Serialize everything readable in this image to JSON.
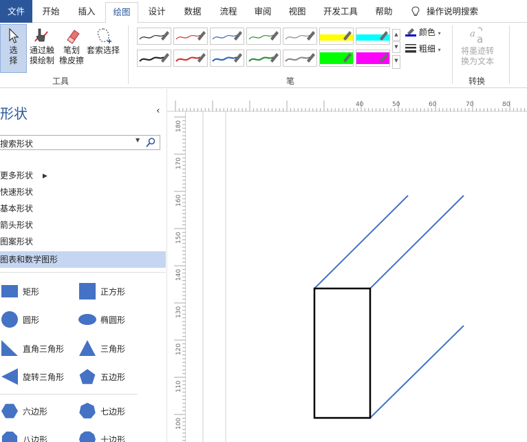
{
  "tabs": [
    {
      "label": "文件"
    },
    {
      "label": "开始"
    },
    {
      "label": "插入"
    },
    {
      "label": "绘图"
    },
    {
      "label": "设计"
    },
    {
      "label": "数据"
    },
    {
      "label": "流程"
    },
    {
      "label": "审阅"
    },
    {
      "label": "视图"
    },
    {
      "label": "开发工具"
    },
    {
      "label": "帮助"
    }
  ],
  "tell_me": "操作说明搜索",
  "ribbon": {
    "tools": {
      "select_line1": "选",
      "select_line2": "择",
      "touch_line1": "通过触",
      "touch_line2": "摸绘制",
      "eraser_line1": "笔划",
      "eraser_line2": "橡皮擦",
      "lasso": "套索选择",
      "group_label": "工具"
    },
    "pens": {
      "group_label": "笔",
      "colors": [
        "#262626",
        "#d13438",
        "#2e6bb8",
        "#2f8f3c",
        "#8a8a8a",
        "#ffff00",
        "#00ffff",
        "#262626",
        "#d13438",
        "#2e6bb8",
        "#2f8f3c",
        "#8a8a8a",
        "#00ff00",
        "#ff00ff"
      ]
    },
    "color_label": "颜色",
    "thickness_label": "粗细",
    "convert": {
      "line1": "将墨迹转",
      "line2": "换为文本",
      "group_label": "转换"
    }
  },
  "shapes_pane": {
    "title": "形状",
    "search_placeholder": "搜索形状",
    "stencils": [
      "更多形状",
      "快速形状",
      "基本形状",
      "箭头形状",
      "图案形状",
      "图表和数学图形"
    ],
    "items": [
      {
        "label": "矩形",
        "icon": "rectangle-icon"
      },
      {
        "label": "正方形",
        "icon": "square-icon"
      },
      {
        "label": "圆形",
        "icon": "circle-icon"
      },
      {
        "label": "椭圆形",
        "icon": "ellipse-icon"
      },
      {
        "label": "直角三角形",
        "icon": "right-triangle-icon"
      },
      {
        "label": "三角形",
        "icon": "triangle-icon"
      },
      {
        "label": "旋转三角形",
        "icon": "rotated-triangle-icon"
      },
      {
        "label": "五边形",
        "icon": "pentagon-icon"
      },
      {
        "label": "六边形",
        "icon": "hexagon-icon"
      },
      {
        "label": "七边形",
        "icon": "heptagon-icon"
      },
      {
        "label": "八边形",
        "icon": "octagon-icon"
      },
      {
        "label": "十边形",
        "icon": "decagon-icon"
      }
    ],
    "shape_color": "#4472c4"
  },
  "rulers": {
    "horizontal": [
      "40",
      "50",
      "60",
      "70",
      "80"
    ],
    "vertical": [
      "180",
      "170",
      "160",
      "150",
      "140",
      "130",
      "120",
      "110",
      "100"
    ]
  },
  "colors": {
    "accent": "#2b579a",
    "line_color": "#4472c4",
    "selected_stencil": "#c5d6f2"
  }
}
